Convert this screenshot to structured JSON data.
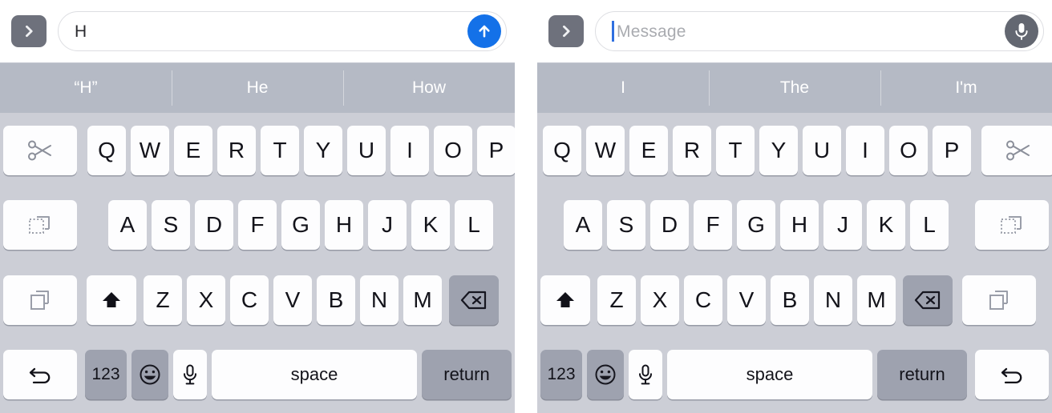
{
  "panels": [
    {
      "id": "left",
      "message_bar": {
        "expand_button_icon": "chevron-right-icon",
        "input_value": "H",
        "input_placeholder": "",
        "show_caret": false,
        "action_button": {
          "icon": "arrow-up-icon",
          "label": "Send",
          "color": "#1471e8"
        }
      },
      "suggestions": [
        "“H”",
        "He",
        "How"
      ],
      "edge_keys_side": "left",
      "edge_keys": [
        {
          "name": "cut-key",
          "icon": "scissors-icon"
        },
        {
          "name": "paste-key",
          "icon": "paste-icon"
        },
        {
          "name": "copy-key",
          "icon": "copy-icon"
        },
        {
          "name": "undo-key",
          "icon": "undo-icon"
        }
      ],
      "rows": {
        "row1": [
          "Q",
          "W",
          "E",
          "R",
          "T",
          "Y",
          "U",
          "I",
          "O",
          "P"
        ],
        "row2": [
          "A",
          "S",
          "D",
          "F",
          "G",
          "H",
          "J",
          "K",
          "L"
        ],
        "row3": [
          "Z",
          "X",
          "C",
          "V",
          "B",
          "N",
          "M"
        ]
      },
      "bottom_row": {
        "shift_icon": "shift-up-arrow-icon",
        "backspace_icon": "backspace-delete-icon",
        "numbers_label": "123",
        "emoji_icon": "smiley-face-icon",
        "dictation_icon": "microphone-icon",
        "space_label": "space",
        "return_label": "return"
      }
    },
    {
      "id": "right",
      "message_bar": {
        "expand_button_icon": "chevron-right-icon",
        "input_value": "",
        "input_placeholder": "Message",
        "show_caret": true,
        "action_button": {
          "icon": "microphone-icon",
          "label": "Dictate",
          "color": "#636771"
        }
      },
      "suggestions": [
        "I",
        "The",
        "I'm"
      ],
      "edge_keys_side": "right",
      "edge_keys": [
        {
          "name": "cut-key",
          "icon": "scissors-icon"
        },
        {
          "name": "paste-key",
          "icon": "paste-icon"
        },
        {
          "name": "copy-key",
          "icon": "copy-icon"
        },
        {
          "name": "undo-key",
          "icon": "undo-icon"
        }
      ],
      "rows": {
        "row1": [
          "Q",
          "W",
          "E",
          "R",
          "T",
          "Y",
          "U",
          "I",
          "O",
          "P"
        ],
        "row2": [
          "A",
          "S",
          "D",
          "F",
          "G",
          "H",
          "J",
          "K",
          "L"
        ],
        "row3": [
          "Z",
          "X",
          "C",
          "V",
          "B",
          "N",
          "M"
        ]
      },
      "bottom_row": {
        "shift_icon": "shift-up-arrow-icon",
        "backspace_icon": "backspace-delete-icon",
        "numbers_label": "123",
        "emoji_icon": "smiley-face-icon",
        "dictation_icon": "microphone-icon",
        "space_label": "space",
        "return_label": "return"
      }
    }
  ],
  "colors": {
    "keyboard_background": "#ccced6",
    "key_face": "#fdfdfe",
    "key_dark": "#9ea2af",
    "suggestion_bar": "#b5bac5",
    "send_blue": "#1471e8",
    "mic_gray": "#636771",
    "expand_gray": "#6e717c"
  }
}
